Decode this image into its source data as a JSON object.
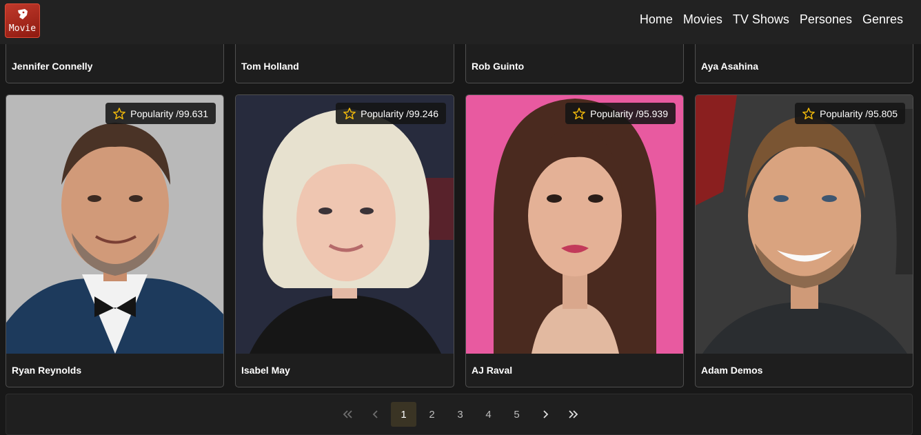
{
  "nav": {
    "logo_text": "Movie",
    "links": [
      "Home",
      "Movies",
      "TV Shows",
      "Persones",
      "Genres"
    ]
  },
  "top_row": [
    {
      "name": "Jennifer Connelly"
    },
    {
      "name": "Tom Holland"
    },
    {
      "name": "Rob Guinto"
    },
    {
      "name": "Aya Asahina"
    }
  ],
  "people": [
    {
      "name": "Ryan Reynolds",
      "popularity": "Popularity /99.631"
    },
    {
      "name": "Isabel May",
      "popularity": "Popularity /99.246"
    },
    {
      "name": "AJ Raval",
      "popularity": "Popularity /95.939"
    },
    {
      "name": "Adam Demos",
      "popularity": "Popularity /95.805"
    }
  ],
  "pagination": {
    "first_icon": "double-chevron-left-icon",
    "prev_icon": "chevron-left-icon",
    "pages": [
      "1",
      "2",
      "3",
      "4",
      "5"
    ],
    "active_page": "1",
    "next_icon": "chevron-right-icon",
    "last_icon": "double-chevron-right-icon"
  },
  "colors": {
    "accent": "#f0b90b",
    "active_page_bg": "#3a3424"
  }
}
